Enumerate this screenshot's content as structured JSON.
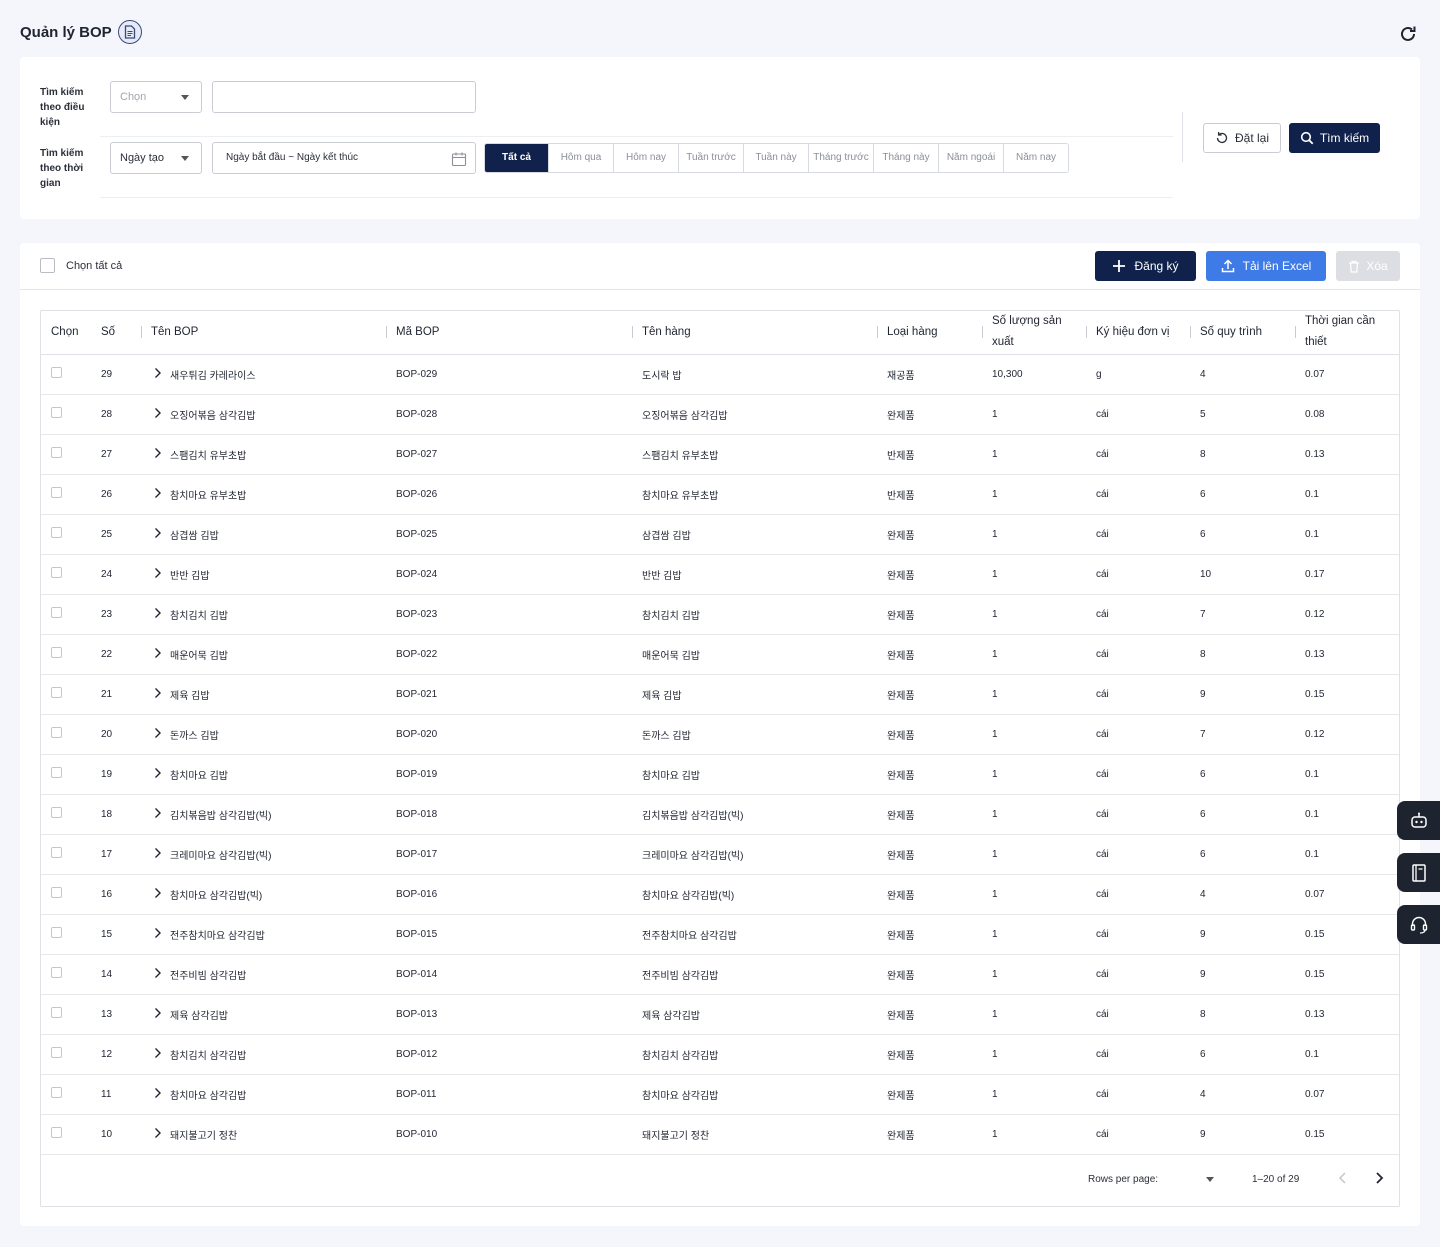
{
  "header": {
    "title": "Quản lý BOP"
  },
  "search": {
    "cond_label": "Tìm kiếm theo điều kiện",
    "cond_select_placeholder": "Chọn",
    "cond_input_value": "",
    "time_label": "Tìm kiếm theo thời gian",
    "time_select_value": "Ngày tạo",
    "date_range_placeholder": "Ngày bắt đầu ~ Ngày kết thúc",
    "periods": [
      "Tất cả",
      "Hôm qua",
      "Hôm nay",
      "Tuần trước",
      "Tuần này",
      "Tháng trước",
      "Tháng này",
      "Năm ngoái",
      "Năm nay"
    ],
    "active_period": "Tất cả",
    "reset_label": "Đặt lại",
    "search_label": "Tìm kiếm"
  },
  "toolbar": {
    "select_all_label": "Chọn tất cả",
    "register_label": "Đăng ký",
    "upload_label": "Tải lên Excel",
    "delete_label": "Xóa"
  },
  "table": {
    "columns": [
      "Chọn",
      "Số",
      "Tên BOP",
      "Mã BOP",
      "Tên hàng",
      "Loại hàng",
      "Số lượng sản xuất",
      "Ký hiệu đơn vị",
      "Số quy trình",
      "Thời gian cần thiết"
    ],
    "rows": [
      [
        "29",
        "새우튀김 카레라이스",
        "BOP-029",
        "도시락 밥",
        "재공품",
        "10,300",
        "g",
        "4",
        "0.07"
      ],
      [
        "28",
        "오징어볶음 삼각김밥",
        "BOP-028",
        "오징어볶음 삼각김밥",
        "완제품",
        "1",
        "cái",
        "5",
        "0.08"
      ],
      [
        "27",
        "스팸김치 유부초밥",
        "BOP-027",
        "스팸김치 유부초밥",
        "반제품",
        "1",
        "cái",
        "8",
        "0.13"
      ],
      [
        "26",
        "참치마요 유부초밥",
        "BOP-026",
        "참치마요 유부초밥",
        "반제품",
        "1",
        "cái",
        "6",
        "0.1"
      ],
      [
        "25",
        "삼겹쌈 김밥",
        "BOP-025",
        "삼겹쌈 김밥",
        "완제품",
        "1",
        "cái",
        "6",
        "0.1"
      ],
      [
        "24",
        "반반 김밥",
        "BOP-024",
        "반반 김밥",
        "완제품",
        "1",
        "cái",
        "10",
        "0.17"
      ],
      [
        "23",
        "참치김치 김밥",
        "BOP-023",
        "참치김치 김밥",
        "완제품",
        "1",
        "cái",
        "7",
        "0.12"
      ],
      [
        "22",
        "매운어묵 김밥",
        "BOP-022",
        "매운어묵 김밥",
        "완제품",
        "1",
        "cái",
        "8",
        "0.13"
      ],
      [
        "21",
        "제육 김밥",
        "BOP-021",
        "제육 김밥",
        "완제품",
        "1",
        "cái",
        "9",
        "0.15"
      ],
      [
        "20",
        "돈까스 김밥",
        "BOP-020",
        "돈까스 김밥",
        "완제품",
        "1",
        "cái",
        "7",
        "0.12"
      ],
      [
        "19",
        "참치마요 김밥",
        "BOP-019",
        "참치마요 김밥",
        "완제품",
        "1",
        "cái",
        "6",
        "0.1"
      ],
      [
        "18",
        "김치볶음밥 삼각김밥(빅)",
        "BOP-018",
        "김치볶음밥 삼각김밥(빅)",
        "완제품",
        "1",
        "cái",
        "6",
        "0.1"
      ],
      [
        "17",
        "크레미마요 삼각김밥(빅)",
        "BOP-017",
        "크레미마요 삼각김밥(빅)",
        "완제품",
        "1",
        "cái",
        "6",
        "0.1"
      ],
      [
        "16",
        "참치마요 삼각김밥(빅)",
        "BOP-016",
        "참치마요 삼각김밥(빅)",
        "완제품",
        "1",
        "cái",
        "4",
        "0.07"
      ],
      [
        "15",
        "전주참치마요 삼각김밥",
        "BOP-015",
        "전주참치마요 삼각김밥",
        "완제품",
        "1",
        "cái",
        "9",
        "0.15"
      ],
      [
        "14",
        "전주비빔 삼각김밥",
        "BOP-014",
        "전주비빔 삼각김밥",
        "완제품",
        "1",
        "cái",
        "9",
        "0.15"
      ],
      [
        "13",
        "제육 삼각김밥",
        "BOP-013",
        "제육 삼각김밥",
        "완제품",
        "1",
        "cái",
        "8",
        "0.13"
      ],
      [
        "12",
        "참치김치 삼각김밥",
        "BOP-012",
        "참치김치 삼각김밥",
        "완제품",
        "1",
        "cái",
        "6",
        "0.1"
      ],
      [
        "11",
        "참치마요 삼각김밥",
        "BOP-011",
        "참치마요 삼각김밥",
        "완제품",
        "1",
        "cái",
        "4",
        "0.07"
      ],
      [
        "10",
        "돼지불고기 정찬",
        "BOP-010",
        "돼지불고기 정찬",
        "완제품",
        "1",
        "cái",
        "9",
        "0.15"
      ]
    ]
  },
  "pagination": {
    "rows_per_page_label": "Rows per page:",
    "range_label": "1–20 of 29"
  },
  "floating": {
    "icons": [
      "robot-icon",
      "book-icon",
      "headset-icon"
    ]
  },
  "colors": {
    "primary": "#10214b",
    "accent": "#3f7be6",
    "disabled": "#dcdee3"
  }
}
